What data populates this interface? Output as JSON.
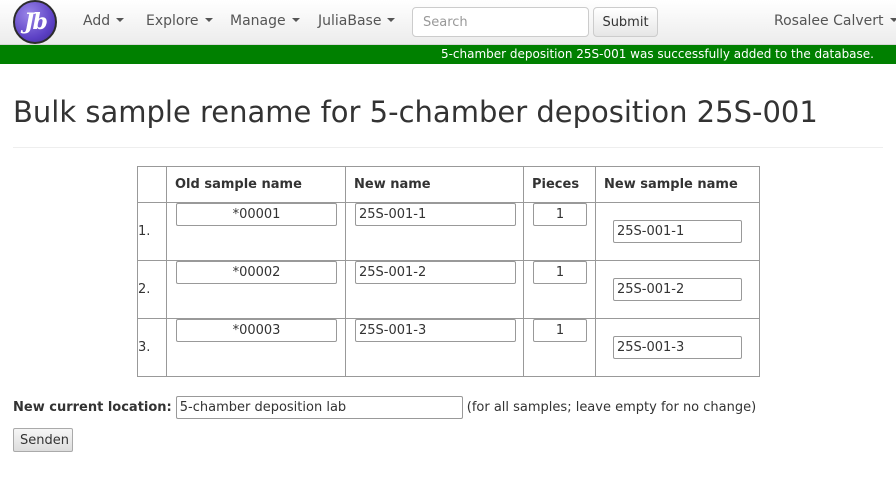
{
  "navbar": {
    "logo_text": "Jb",
    "menus": [
      {
        "label": "Add"
      },
      {
        "label": "Explore"
      },
      {
        "label": "Manage"
      },
      {
        "label": "JuliaBase"
      }
    ],
    "search_placeholder": "Search",
    "search_value": "",
    "submit_label": "Submit",
    "user_name": "Rosalee Calvert"
  },
  "message": {
    "text": "5-chamber deposition 25S-001 was successfully added to the database.",
    "color": "#008000"
  },
  "page": {
    "title": "Bulk sample rename for 5-chamber deposition 25S-001"
  },
  "table": {
    "headers": [
      "",
      "Old sample name",
      "New name",
      "Pieces",
      "New sample name"
    ],
    "rows": [
      {
        "num": "1.",
        "old": "*00001",
        "new": "25S-001-1",
        "pieces": "1",
        "final": "25S-001-1"
      },
      {
        "num": "2.",
        "old": "*00002",
        "new": "25S-001-2",
        "pieces": "1",
        "final": "25S-001-2"
      },
      {
        "num": "3.",
        "old": "*00003",
        "new": "25S-001-3",
        "pieces": "1",
        "final": "25S-001-3"
      }
    ]
  },
  "location": {
    "label": "New current location:",
    "value": "5-chamber deposition lab",
    "hint": "(for all samples; leave empty for no change)"
  },
  "form": {
    "submit_label": "Senden"
  }
}
